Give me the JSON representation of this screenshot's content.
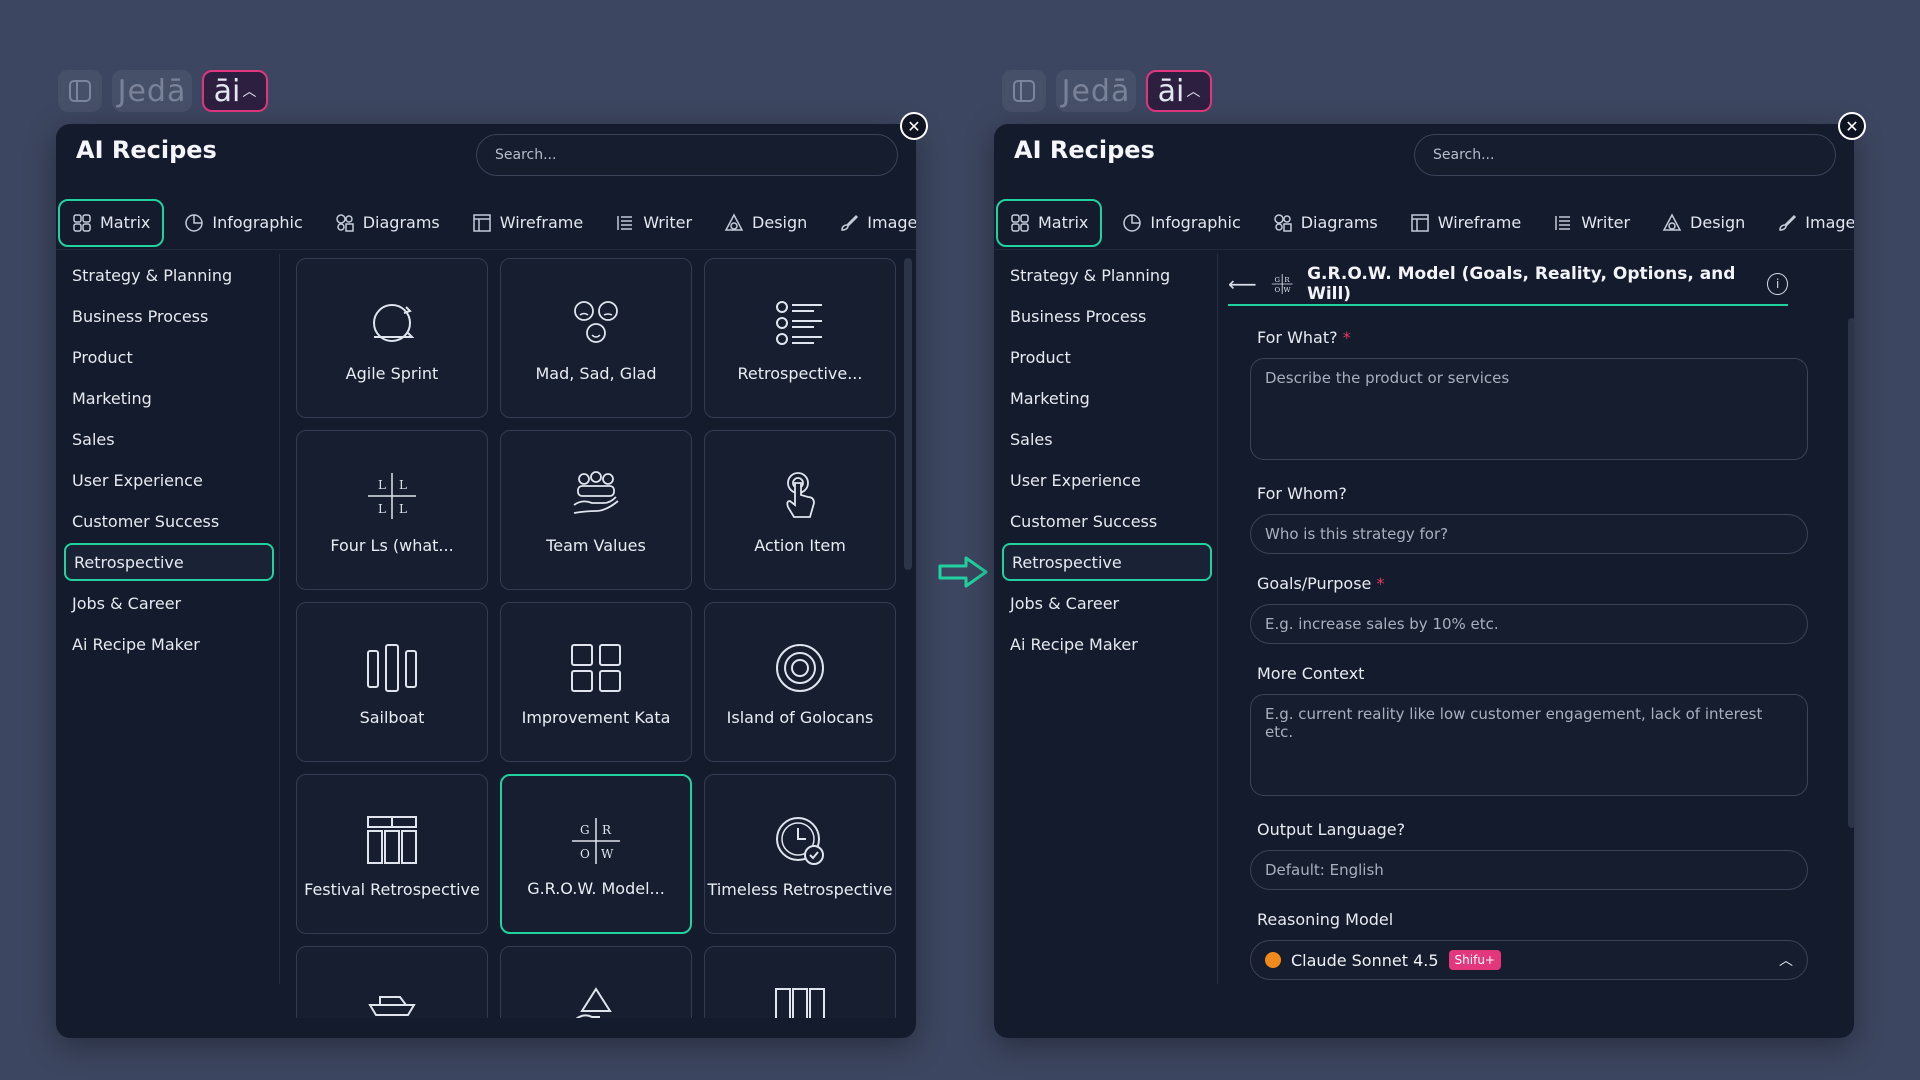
{
  "brand": {
    "logo_text": "Jedā",
    "ai_label": "āi"
  },
  "colors": {
    "accent": "#21d19f",
    "ai_border": "#e0367f",
    "required": "#e23a5b",
    "badge": "#e2367d"
  },
  "panel_title": "AI Recipes",
  "search_placeholder": "Search...",
  "tabs": [
    {
      "label": "Matrix",
      "icon": "grid-icon"
    },
    {
      "label": "Infographic",
      "icon": "pie-chart-icon"
    },
    {
      "label": "Diagrams",
      "icon": "shapes-icon"
    },
    {
      "label": "Wireframe",
      "icon": "wireframe-icon"
    },
    {
      "label": "Writer",
      "icon": "text-lines-icon"
    },
    {
      "label": "Design",
      "icon": "design-icon"
    },
    {
      "label": "Image",
      "icon": "brush-icon"
    }
  ],
  "categories": [
    "Strategy & Planning",
    "Business Process",
    "Product",
    "Marketing",
    "Sales",
    "User Experience",
    "Customer Success",
    "Retrospective",
    "Jobs & Career",
    "Ai Recipe Maker"
  ],
  "active_category": "Retrospective",
  "recipes": [
    {
      "label": "Agile Sprint",
      "icon": "cycle-icon"
    },
    {
      "label": "Mad, Sad, Glad",
      "icon": "emotions-icon"
    },
    {
      "label": "Retrospective...",
      "icon": "list-icon"
    },
    {
      "label": "Four Ls (what...",
      "icon": "four-ls-icon"
    },
    {
      "label": "Team Values",
      "icon": "team-icon"
    },
    {
      "label": "Action Item",
      "icon": "pointer-icon"
    },
    {
      "label": "Sailboat",
      "icon": "columns-icon"
    },
    {
      "label": "Improvement Kata",
      "icon": "squares-icon"
    },
    {
      "label": "Island of Golocans",
      "icon": "target-icon"
    },
    {
      "label": "Festival Retrospective",
      "icon": "layout-icon"
    },
    {
      "label": "G.R.O.W. Model...",
      "icon": "grow-icon"
    },
    {
      "label": "Timeless Retrospective",
      "icon": "clock-icon"
    },
    {
      "label": "",
      "icon": "boat-icon"
    },
    {
      "label": "",
      "icon": "triangle-icon"
    },
    {
      "label": "",
      "icon": "bars-icon"
    }
  ],
  "form": {
    "recipe_title": "G.R.O.W. Model (Goals, Reality, Options, and Will)",
    "fields": {
      "for_what": {
        "label": "For What?",
        "placeholder": "Describe the product or services"
      },
      "for_whom": {
        "label": "For Whom?",
        "placeholder": "Who is this strategy for?"
      },
      "goals": {
        "label": "Goals/Purpose",
        "placeholder": "E.g. increase sales by 10% etc."
      },
      "context": {
        "label": "More Context",
        "placeholder": "E.g. current reality like low customer engagement, lack of interest etc."
      },
      "language": {
        "label": "Output Language?",
        "placeholder": "Default: English"
      }
    },
    "required_mark": "*",
    "model": {
      "label": "Reasoning Model",
      "name": "Claude Sonnet 4.5",
      "badge": "Shifu+"
    }
  }
}
